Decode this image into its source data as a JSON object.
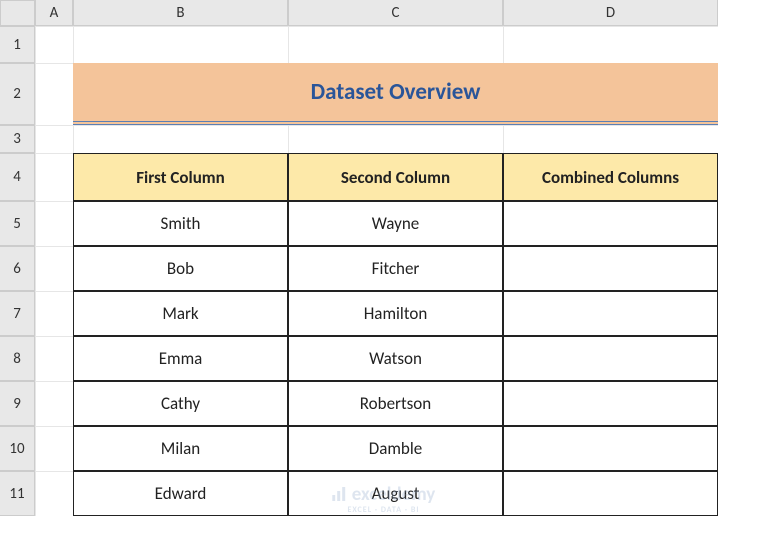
{
  "columns": [
    "A",
    "B",
    "C",
    "D"
  ],
  "rows": [
    "1",
    "2",
    "3",
    "4",
    "5",
    "6",
    "7",
    "8",
    "9",
    "10",
    "11"
  ],
  "title": "Dataset Overview",
  "headers": {
    "b4": "First Column",
    "c4": "Second Column",
    "d4": "Combined Columns"
  },
  "data": {
    "first": [
      "Smith",
      "Bob",
      "Mark",
      "Emma",
      "Cathy",
      "Milan",
      "Edward"
    ],
    "second": [
      "Wayne",
      "Fitcher",
      "Hamilton",
      "Watson",
      "Robertson",
      "Damble",
      "August"
    ],
    "combined": [
      "",
      "",
      "",
      "",
      "",
      "",
      ""
    ]
  },
  "watermark": {
    "brand": "exceldemy",
    "tag": "EXCEL · DATA · BI"
  }
}
